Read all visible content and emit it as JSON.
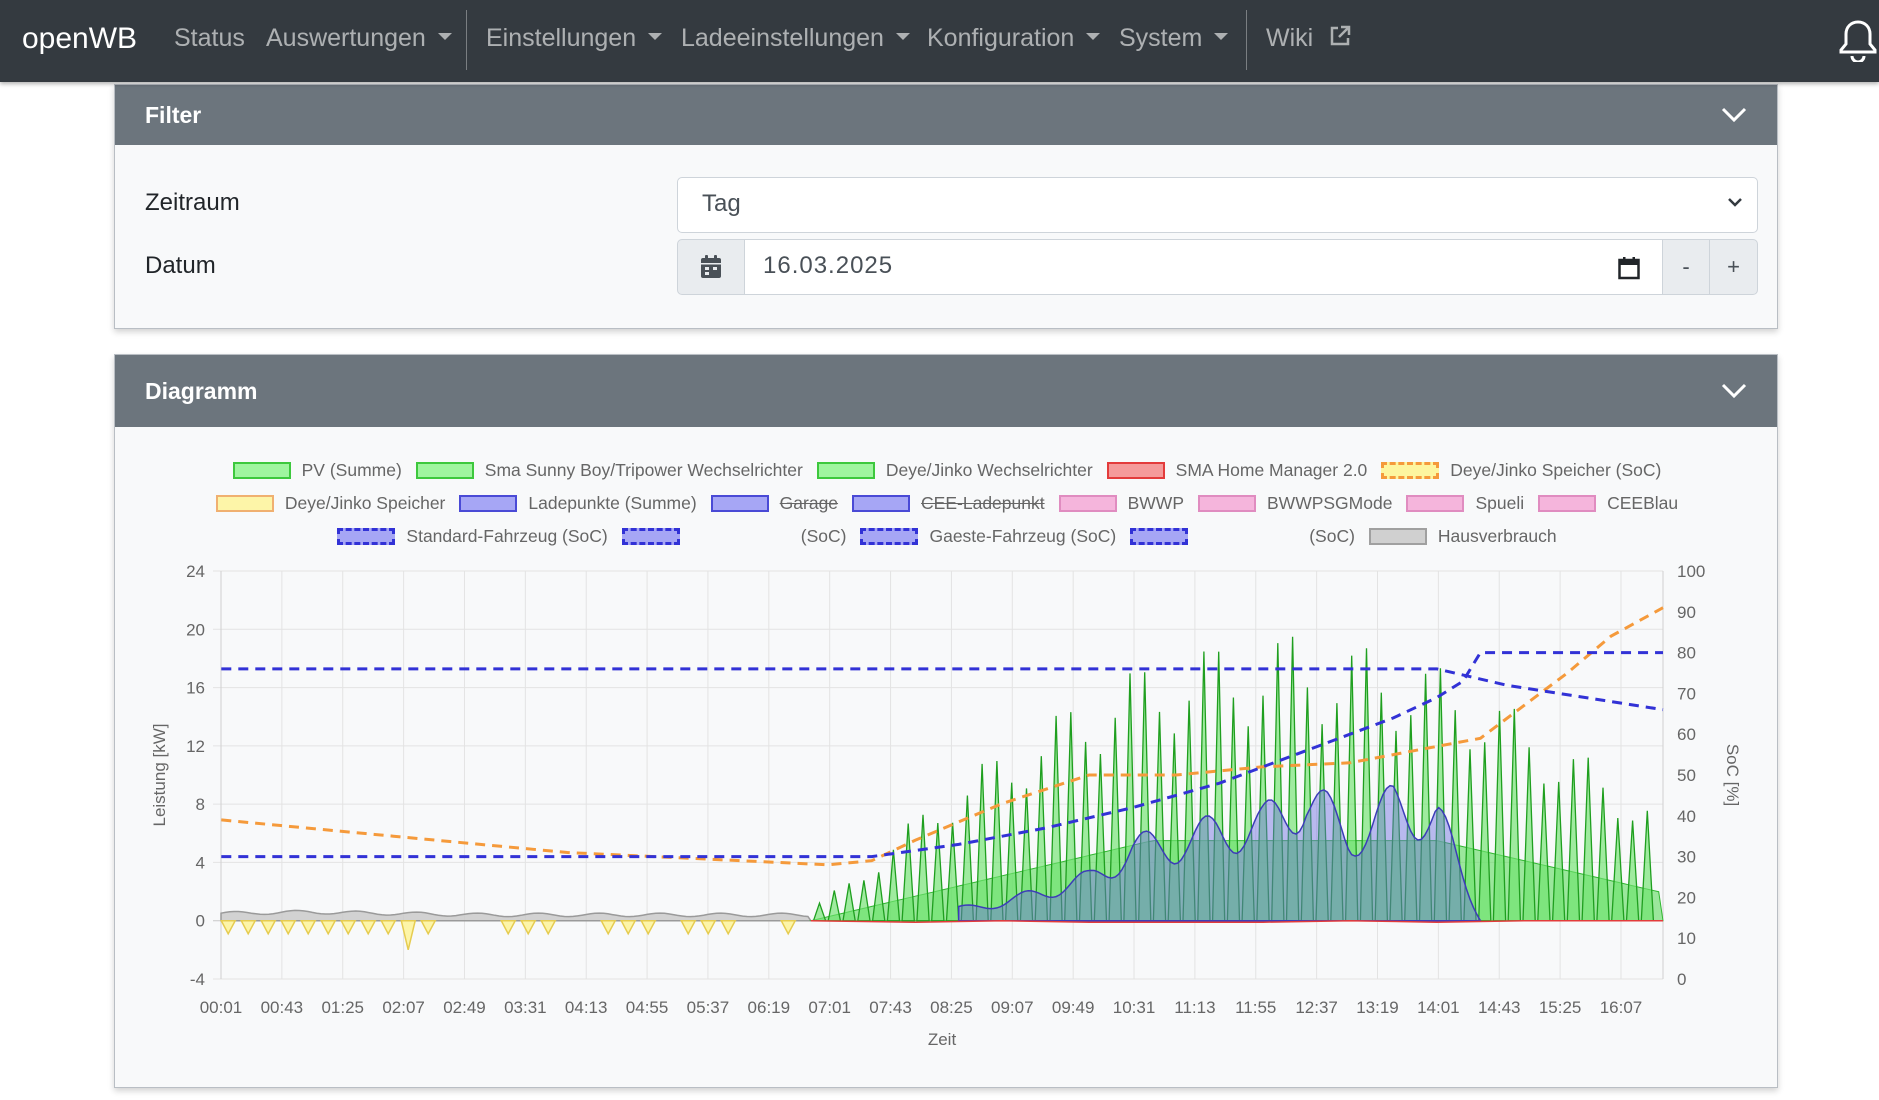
{
  "navbar": {
    "brand": "openWB",
    "items": [
      {
        "label": "Status",
        "dropdown": false
      },
      {
        "label": "Auswertungen",
        "dropdown": true
      },
      {
        "label": "Einstellungen",
        "dropdown": true
      },
      {
        "label": "Ladeeinstellungen",
        "dropdown": true
      },
      {
        "label": "Konfiguration",
        "dropdown": true
      },
      {
        "label": "System",
        "dropdown": true
      },
      {
        "label": "Wiki",
        "dropdown": false
      }
    ]
  },
  "filter": {
    "title": "Filter",
    "zeitraum_label": "Zeitraum",
    "zeitraum_value": "Tag",
    "datum_label": "Datum",
    "datum_value": "16.03.2025",
    "minus_label": "-",
    "plus_label": "+"
  },
  "diagramm": {
    "title": "Diagramm"
  },
  "chart_data": {
    "type": "area",
    "title": "",
    "xlabel": "Zeit",
    "ylabel_left": "Leistung [kW]",
    "ylabel_right": "SoC [%]",
    "ylim_left": [
      -4,
      24
    ],
    "ylim_right": [
      0,
      100
    ],
    "yticks_left": [
      -4,
      0,
      4,
      8,
      12,
      16,
      20,
      24
    ],
    "yticks_right": [
      0,
      10,
      20,
      30,
      40,
      50,
      60,
      70,
      80,
      90,
      100
    ],
    "xticks": [
      "00:01",
      "00:43",
      "01:25",
      "02:07",
      "02:49",
      "03:31",
      "04:13",
      "04:55",
      "05:37",
      "06:19",
      "07:01",
      "07:43",
      "08:25",
      "09:07",
      "09:49",
      "10:31",
      "11:13",
      "11:55",
      "12:37",
      "13:19",
      "14:01",
      "14:43",
      "15:25",
      "16:07"
    ],
    "x_range_hours": [
      0.0167,
      16.6
    ],
    "grid": true,
    "legend_position": "top",
    "legend": [
      {
        "label": "PV (Summe)",
        "style": "fill",
        "color": "#9ff59f",
        "border": "#3dc83d",
        "struck": false
      },
      {
        "label": "Sma Sunny Boy/Tripower Wechselrichter",
        "style": "fill",
        "color": "#9ff59f",
        "border": "#3dc83d",
        "struck": false
      },
      {
        "label": "Deye/Jinko Wechselrichter",
        "style": "fill",
        "color": "#9ff59f",
        "border": "#3dc83d",
        "struck": false
      },
      {
        "label": "SMA Home Manager 2.0",
        "style": "fill",
        "color": "#f59a9a",
        "border": "#e33b3b",
        "struck": false
      },
      {
        "label": "Deye/Jinko Speicher (SoC)",
        "style": "dashed",
        "color": "#fdf59f",
        "border": "#f59a3b",
        "struck": false
      },
      {
        "label": "Deye/Jinko Speicher",
        "style": "fill",
        "color": "#fdf5a8",
        "border": "#f0b070",
        "struck": false
      },
      {
        "label": "Ladepunkte (Summe)",
        "style": "fill",
        "color": "#a6a6f5",
        "border": "#4a4ad6",
        "struck": false
      },
      {
        "label": "Garage",
        "style": "fill",
        "color": "#a6a6f5",
        "border": "#4a4ad6",
        "struck": true
      },
      {
        "label": "CEE-Ladepunkt",
        "style": "fill",
        "color": "#a6a6f5",
        "border": "#4a4ad6",
        "struck": true
      },
      {
        "label": "BWWP",
        "style": "fill",
        "color": "#f5b5dc",
        "border": "#e08cc0",
        "struck": false
      },
      {
        "label": "BWWPSGMode",
        "style": "fill",
        "color": "#f5b5dc",
        "border": "#e08cc0",
        "struck": false
      },
      {
        "label": "Spueli",
        "style": "fill",
        "color": "#f5b5dc",
        "border": "#e08cc0",
        "struck": false
      },
      {
        "label": "CEEBlau",
        "style": "fill",
        "color": "#f5b5dc",
        "border": "#e08cc0",
        "struck": false
      },
      {
        "label": "Standard-Fahrzeug (SoC)",
        "style": "dashed",
        "color": "#a6a6f5",
        "border": "#3232d6",
        "struck": false
      },
      {
        "label": "(SoC)",
        "style": "dashed",
        "color": "#a6a6f5",
        "border": "#3232d6",
        "struck": false,
        "masked_prefix": true
      },
      {
        "label": "Gaeste-Fahrzeug (SoC)",
        "style": "dashed",
        "color": "#a6a6f5",
        "border": "#3232d6",
        "struck": false
      },
      {
        "label": "(SoC)",
        "style": "dashed",
        "color": "#a6a6f5",
        "border": "#3232d6",
        "struck": false,
        "masked_prefix": true
      },
      {
        "label": "Hausverbrauch",
        "style": "fill",
        "color": "#d0d0d0",
        "border": "#a0a0a0",
        "struck": false
      }
    ],
    "series": [
      {
        "name": "Hausverbrauch",
        "axis": "kW",
        "color": "#b0b0b0",
        "x": [
          0.02,
          1,
          2,
          3,
          4,
          5,
          6,
          7,
          8,
          9,
          10,
          11,
          12,
          13,
          14,
          15,
          16,
          16.6
        ],
        "values": [
          0.5,
          0.6,
          0.5,
          0.4,
          0.4,
          0.4,
          0.4,
          0.4,
          0.4,
          0.4,
          0.4,
          0.4,
          0.4,
          0.4,
          0.4,
          0.4,
          0.4,
          0.4
        ]
      },
      {
        "name": "PV (Summe)",
        "axis": "kW",
        "color": "#32d232",
        "pattern": "spiky",
        "x": [
          6.8,
          7.3,
          7.8,
          8.3,
          8.8,
          9.3,
          9.8,
          10.3,
          10.8,
          11.3,
          11.8,
          12.3,
          12.8,
          13.3,
          13.8,
          14.3,
          14.8,
          15.3,
          15.8,
          16.3,
          16.6
        ],
        "values": [
          1,
          3,
          6,
          9,
          11,
          13,
          15,
          17,
          18,
          19,
          19,
          20,
          19,
          19,
          18,
          17,
          15,
          13,
          11,
          9,
          7
        ]
      },
      {
        "name": "Ladepunkte (Summe)",
        "axis": "kW",
        "color": "#6a6ae0",
        "x": [
          8.5,
          9.0,
          9.5,
          10.0,
          10.5,
          11.0,
          11.5,
          12.0,
          12.5,
          13.0,
          13.5,
          14.0,
          14.5
        ],
        "values": [
          1,
          1.5,
          2.5,
          3.5,
          6,
          6.5,
          7.5,
          8,
          10.5,
          7,
          9.5,
          9,
          0
        ]
      },
      {
        "name": "Deye/Jinko Speicher",
        "axis": "kW",
        "color": "#f0e060",
        "x": [
          0.1,
          0.4,
          0.7,
          1.0,
          1.3,
          1.6,
          1.9,
          2.2,
          2.5,
          3.2,
          3.9,
          4.6,
          5.3,
          6.0,
          6.5
        ],
        "values": [
          -0.8,
          -0.8,
          -0.8,
          -0.8,
          -0.8,
          -0.8,
          -0.8,
          -2.0,
          -0.8,
          -0.8,
          -0.8,
          -0.8,
          -0.8,
          -0.8,
          -0.8
        ]
      },
      {
        "name": "Deye/Jinko Speicher (SoC)",
        "axis": "%",
        "color": "#f59a3b",
        "dash": true,
        "x": [
          0.02,
          1,
          2,
          3,
          4,
          5,
          6,
          7,
          7.5,
          8,
          9,
          10,
          11,
          12,
          13,
          14,
          14.5,
          15,
          15.5,
          16,
          16.6
        ],
        "values": [
          39,
          37,
          35,
          33,
          31,
          30,
          29,
          28,
          29,
          34,
          43,
          50,
          50,
          52,
          53,
          57,
          59,
          67,
          75,
          84,
          91
        ]
      },
      {
        "name": "Standard-Fahrzeug (SoC)",
        "axis": "%",
        "color": "#3232d6",
        "dash": true,
        "x": [
          0.02,
          7.5,
          8.5,
          9.5,
          10.5,
          11.5,
          12.0,
          12.5,
          13.0,
          13.5,
          14.0,
          14.3,
          14.5,
          16.6
        ],
        "values": [
          30,
          30,
          33,
          37,
          42,
          48,
          52,
          56,
          60,
          64,
          69,
          73,
          80,
          80
        ]
      },
      {
        "name": "Gaeste-Fahrzeug (SoC)",
        "axis": "%",
        "color": "#3232d6",
        "dash": true,
        "x": [
          0.02,
          14.0,
          14.8,
          16.6
        ],
        "values": [
          76,
          76,
          72,
          66
        ]
      },
      {
        "name": "SMA Home Manager 2.0",
        "axis": "kW",
        "color": "#e33b3b",
        "x": [
          6.8,
          8,
          9,
          10,
          11,
          12,
          13,
          14,
          15,
          16.6
        ],
        "values": [
          0,
          -0.1,
          0,
          -0.1,
          -0.1,
          -0.1,
          0,
          -0.1,
          0,
          0
        ]
      }
    ]
  }
}
